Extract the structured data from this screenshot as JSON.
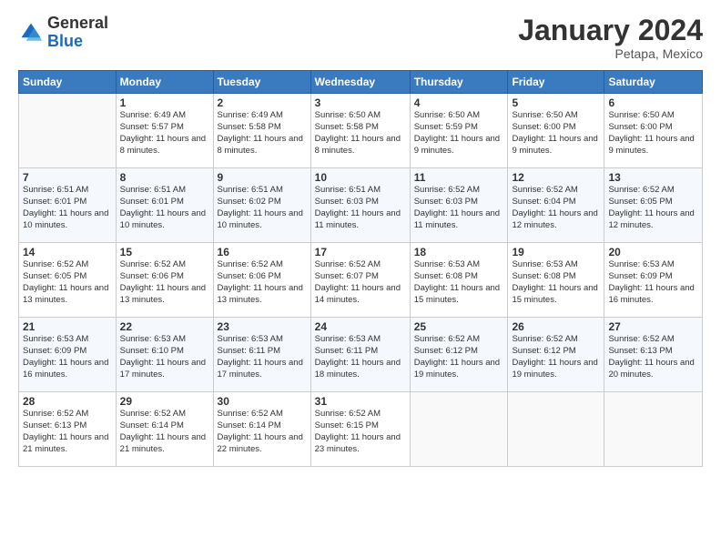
{
  "logo": {
    "general": "General",
    "blue": "Blue"
  },
  "header": {
    "month": "January 2024",
    "location": "Petapa, Mexico"
  },
  "weekdays": [
    "Sunday",
    "Monday",
    "Tuesday",
    "Wednesday",
    "Thursday",
    "Friday",
    "Saturday"
  ],
  "weeks": [
    [
      {
        "day": "",
        "sunrise": "",
        "sunset": "",
        "daylight": ""
      },
      {
        "day": "1",
        "sunrise": "Sunrise: 6:49 AM",
        "sunset": "Sunset: 5:57 PM",
        "daylight": "Daylight: 11 hours and 8 minutes."
      },
      {
        "day": "2",
        "sunrise": "Sunrise: 6:49 AM",
        "sunset": "Sunset: 5:58 PM",
        "daylight": "Daylight: 11 hours and 8 minutes."
      },
      {
        "day": "3",
        "sunrise": "Sunrise: 6:50 AM",
        "sunset": "Sunset: 5:58 PM",
        "daylight": "Daylight: 11 hours and 8 minutes."
      },
      {
        "day": "4",
        "sunrise": "Sunrise: 6:50 AM",
        "sunset": "Sunset: 5:59 PM",
        "daylight": "Daylight: 11 hours and 9 minutes."
      },
      {
        "day": "5",
        "sunrise": "Sunrise: 6:50 AM",
        "sunset": "Sunset: 6:00 PM",
        "daylight": "Daylight: 11 hours and 9 minutes."
      },
      {
        "day": "6",
        "sunrise": "Sunrise: 6:50 AM",
        "sunset": "Sunset: 6:00 PM",
        "daylight": "Daylight: 11 hours and 9 minutes."
      }
    ],
    [
      {
        "day": "7",
        "sunrise": "Sunrise: 6:51 AM",
        "sunset": "Sunset: 6:01 PM",
        "daylight": "Daylight: 11 hours and 10 minutes."
      },
      {
        "day": "8",
        "sunrise": "Sunrise: 6:51 AM",
        "sunset": "Sunset: 6:01 PM",
        "daylight": "Daylight: 11 hours and 10 minutes."
      },
      {
        "day": "9",
        "sunrise": "Sunrise: 6:51 AM",
        "sunset": "Sunset: 6:02 PM",
        "daylight": "Daylight: 11 hours and 10 minutes."
      },
      {
        "day": "10",
        "sunrise": "Sunrise: 6:51 AM",
        "sunset": "Sunset: 6:03 PM",
        "daylight": "Daylight: 11 hours and 11 minutes."
      },
      {
        "day": "11",
        "sunrise": "Sunrise: 6:52 AM",
        "sunset": "Sunset: 6:03 PM",
        "daylight": "Daylight: 11 hours and 11 minutes."
      },
      {
        "day": "12",
        "sunrise": "Sunrise: 6:52 AM",
        "sunset": "Sunset: 6:04 PM",
        "daylight": "Daylight: 11 hours and 12 minutes."
      },
      {
        "day": "13",
        "sunrise": "Sunrise: 6:52 AM",
        "sunset": "Sunset: 6:05 PM",
        "daylight": "Daylight: 11 hours and 12 minutes."
      }
    ],
    [
      {
        "day": "14",
        "sunrise": "Sunrise: 6:52 AM",
        "sunset": "Sunset: 6:05 PM",
        "daylight": "Daylight: 11 hours and 13 minutes."
      },
      {
        "day": "15",
        "sunrise": "Sunrise: 6:52 AM",
        "sunset": "Sunset: 6:06 PM",
        "daylight": "Daylight: 11 hours and 13 minutes."
      },
      {
        "day": "16",
        "sunrise": "Sunrise: 6:52 AM",
        "sunset": "Sunset: 6:06 PM",
        "daylight": "Daylight: 11 hours and 13 minutes."
      },
      {
        "day": "17",
        "sunrise": "Sunrise: 6:52 AM",
        "sunset": "Sunset: 6:07 PM",
        "daylight": "Daylight: 11 hours and 14 minutes."
      },
      {
        "day": "18",
        "sunrise": "Sunrise: 6:53 AM",
        "sunset": "Sunset: 6:08 PM",
        "daylight": "Daylight: 11 hours and 15 minutes."
      },
      {
        "day": "19",
        "sunrise": "Sunrise: 6:53 AM",
        "sunset": "Sunset: 6:08 PM",
        "daylight": "Daylight: 11 hours and 15 minutes."
      },
      {
        "day": "20",
        "sunrise": "Sunrise: 6:53 AM",
        "sunset": "Sunset: 6:09 PM",
        "daylight": "Daylight: 11 hours and 16 minutes."
      }
    ],
    [
      {
        "day": "21",
        "sunrise": "Sunrise: 6:53 AM",
        "sunset": "Sunset: 6:09 PM",
        "daylight": "Daylight: 11 hours and 16 minutes."
      },
      {
        "day": "22",
        "sunrise": "Sunrise: 6:53 AM",
        "sunset": "Sunset: 6:10 PM",
        "daylight": "Daylight: 11 hours and 17 minutes."
      },
      {
        "day": "23",
        "sunrise": "Sunrise: 6:53 AM",
        "sunset": "Sunset: 6:11 PM",
        "daylight": "Daylight: 11 hours and 17 minutes."
      },
      {
        "day": "24",
        "sunrise": "Sunrise: 6:53 AM",
        "sunset": "Sunset: 6:11 PM",
        "daylight": "Daylight: 11 hours and 18 minutes."
      },
      {
        "day": "25",
        "sunrise": "Sunrise: 6:52 AM",
        "sunset": "Sunset: 6:12 PM",
        "daylight": "Daylight: 11 hours and 19 minutes."
      },
      {
        "day": "26",
        "sunrise": "Sunrise: 6:52 AM",
        "sunset": "Sunset: 6:12 PM",
        "daylight": "Daylight: 11 hours and 19 minutes."
      },
      {
        "day": "27",
        "sunrise": "Sunrise: 6:52 AM",
        "sunset": "Sunset: 6:13 PM",
        "daylight": "Daylight: 11 hours and 20 minutes."
      }
    ],
    [
      {
        "day": "28",
        "sunrise": "Sunrise: 6:52 AM",
        "sunset": "Sunset: 6:13 PM",
        "daylight": "Daylight: 11 hours and 21 minutes."
      },
      {
        "day": "29",
        "sunrise": "Sunrise: 6:52 AM",
        "sunset": "Sunset: 6:14 PM",
        "daylight": "Daylight: 11 hours and 21 minutes."
      },
      {
        "day": "30",
        "sunrise": "Sunrise: 6:52 AM",
        "sunset": "Sunset: 6:14 PM",
        "daylight": "Daylight: 11 hours and 22 minutes."
      },
      {
        "day": "31",
        "sunrise": "Sunrise: 6:52 AM",
        "sunset": "Sunset: 6:15 PM",
        "daylight": "Daylight: 11 hours and 23 minutes."
      },
      {
        "day": "",
        "sunrise": "",
        "sunset": "",
        "daylight": ""
      },
      {
        "day": "",
        "sunrise": "",
        "sunset": "",
        "daylight": ""
      },
      {
        "day": "",
        "sunrise": "",
        "sunset": "",
        "daylight": ""
      }
    ]
  ]
}
